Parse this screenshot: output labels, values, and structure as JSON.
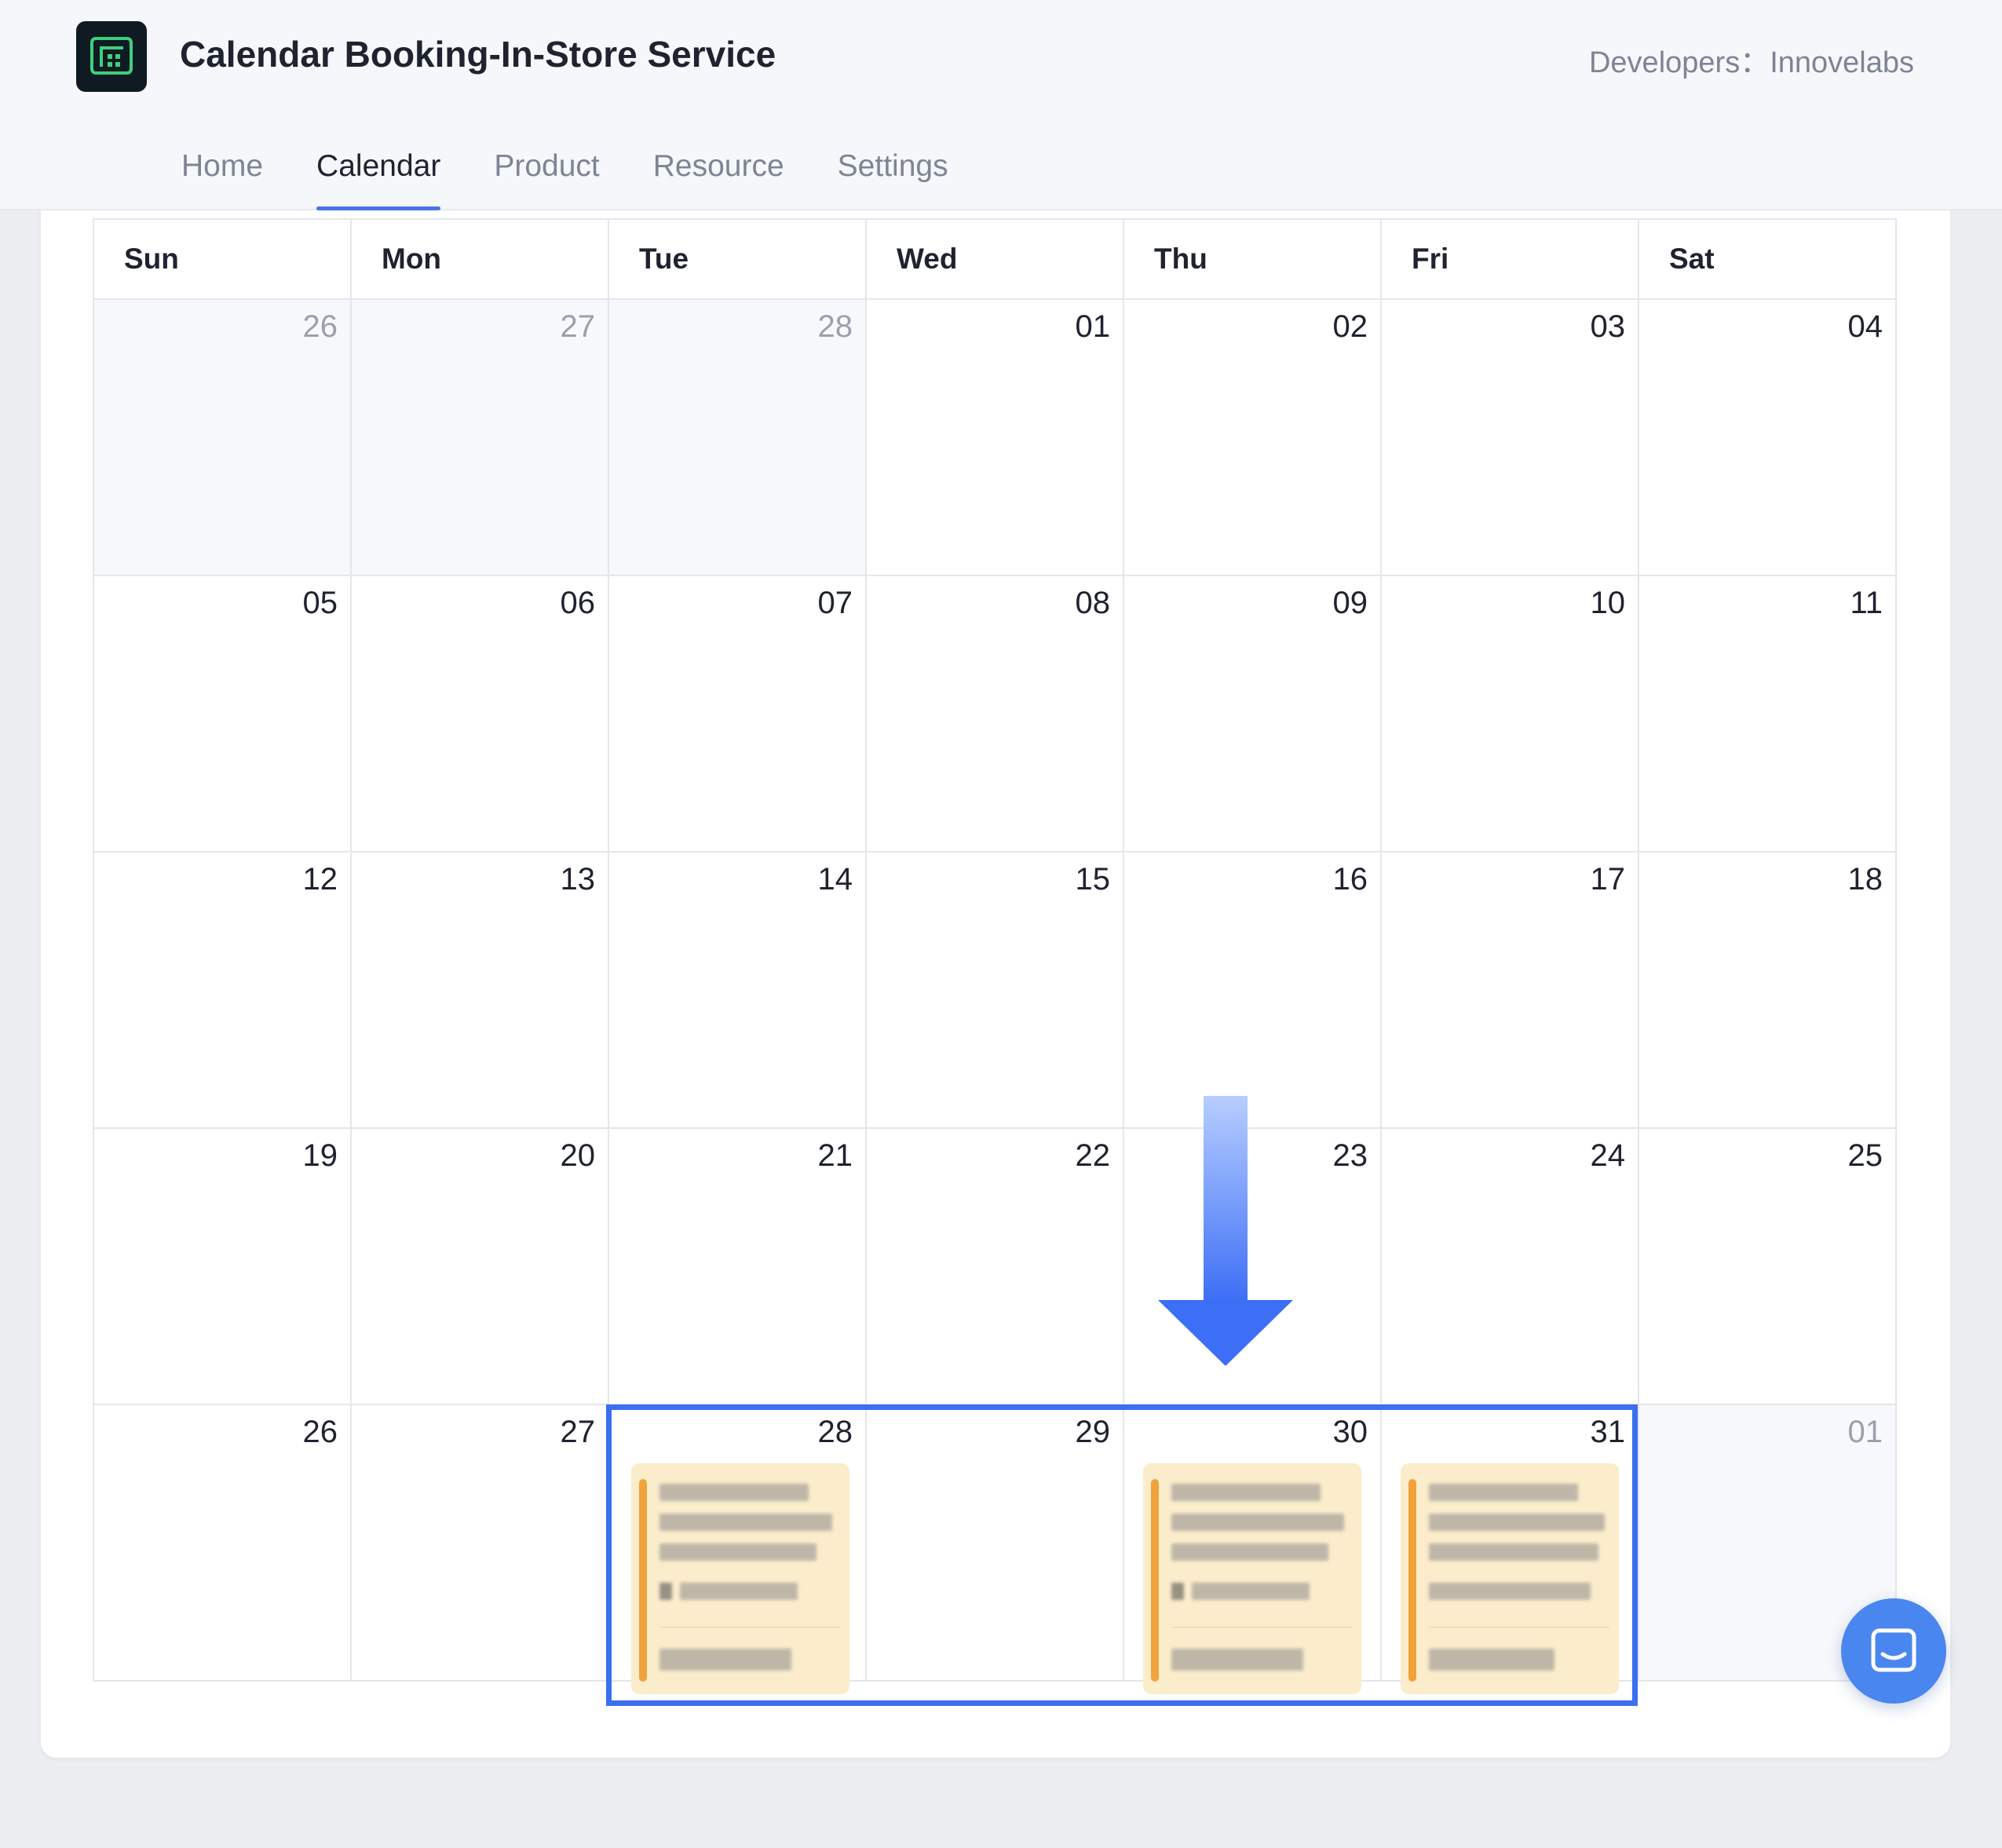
{
  "header": {
    "title": "Calendar Booking-In-Store Service",
    "developer_credit": "Developers：Innovelabs",
    "logo_icon": "grid-app-icon"
  },
  "nav": {
    "tabs": [
      {
        "label": "Home",
        "active": false
      },
      {
        "label": "Calendar",
        "active": true
      },
      {
        "label": "Product",
        "active": false
      },
      {
        "label": "Resource",
        "active": false
      },
      {
        "label": "Settings",
        "active": false
      }
    ]
  },
  "calendar": {
    "weekdays": [
      "Sun",
      "Mon",
      "Tue",
      "Wed",
      "Thu",
      "Fri",
      "Sat"
    ],
    "weeks": [
      [
        "26",
        "27",
        "28",
        "01",
        "02",
        "03",
        "04"
      ],
      [
        "05",
        "06",
        "07",
        "08",
        "09",
        "10",
        "11"
      ],
      [
        "12",
        "13",
        "14",
        "15",
        "16",
        "17",
        "18"
      ],
      [
        "19",
        "20",
        "21",
        "22",
        "23",
        "24",
        "25"
      ],
      [
        "26",
        "27",
        "28",
        "29",
        "30",
        "31",
        "01"
      ]
    ],
    "out_of_month": [
      [
        0,
        0
      ],
      [
        0,
        1
      ],
      [
        0,
        2
      ],
      [
        4,
        6
      ]
    ],
    "booked_days": [
      "28",
      "30",
      "31"
    ],
    "event_color": "#fbeccb",
    "event_accent": "#efa33a"
  },
  "annotation": {
    "highlight_color": "#3b6ff0",
    "arrow_icon": "down-arrow-icon"
  },
  "chat": {
    "icon": "chat-bubble-icon",
    "color": "#4a86f0"
  }
}
